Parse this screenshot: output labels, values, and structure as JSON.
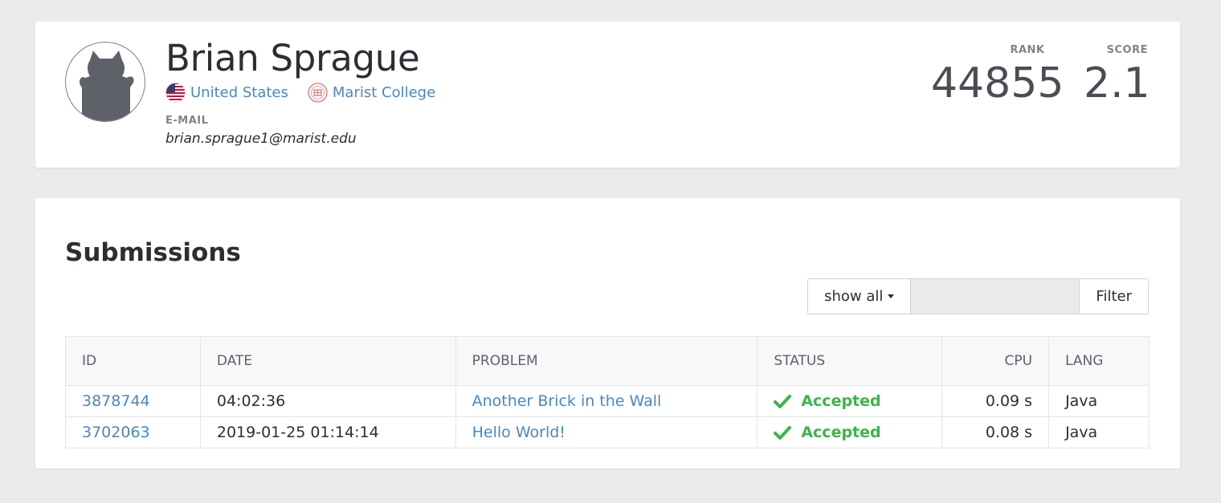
{
  "profile": {
    "name": "Brian Sprague",
    "country": "United States",
    "university": "Marist College",
    "email_label": "E-MAIL",
    "email": "brian.sprague1@marist.edu",
    "rank_label": "RANK",
    "rank": "44855",
    "score_label": "SCORE",
    "score": "2.1"
  },
  "submissions": {
    "title": "Submissions",
    "filter": {
      "dropdown_label": "show all",
      "input_value": "",
      "button_label": "Filter"
    },
    "columns": [
      "ID",
      "DATE",
      "PROBLEM",
      "STATUS",
      "CPU",
      "LANG"
    ],
    "rows": [
      {
        "id": "3878744",
        "date": "04:02:36",
        "problem": "Another Brick in the Wall",
        "status": "Accepted",
        "cpu": "0.09 s",
        "lang": "Java"
      },
      {
        "id": "3702063",
        "date": "2019-01-25 01:14:14",
        "problem": "Hello World!",
        "status": "Accepted",
        "cpu": "0.08 s",
        "lang": "Java"
      }
    ]
  },
  "colors": {
    "link": "#4a86c5",
    "accepted": "#3bb54a",
    "background": "#ebebeb"
  },
  "icons": {
    "avatar": "cat-silhouette-avatar",
    "country_flag": "us-flag-icon",
    "university_seal": "university-seal-icon",
    "status": "check-icon"
  }
}
